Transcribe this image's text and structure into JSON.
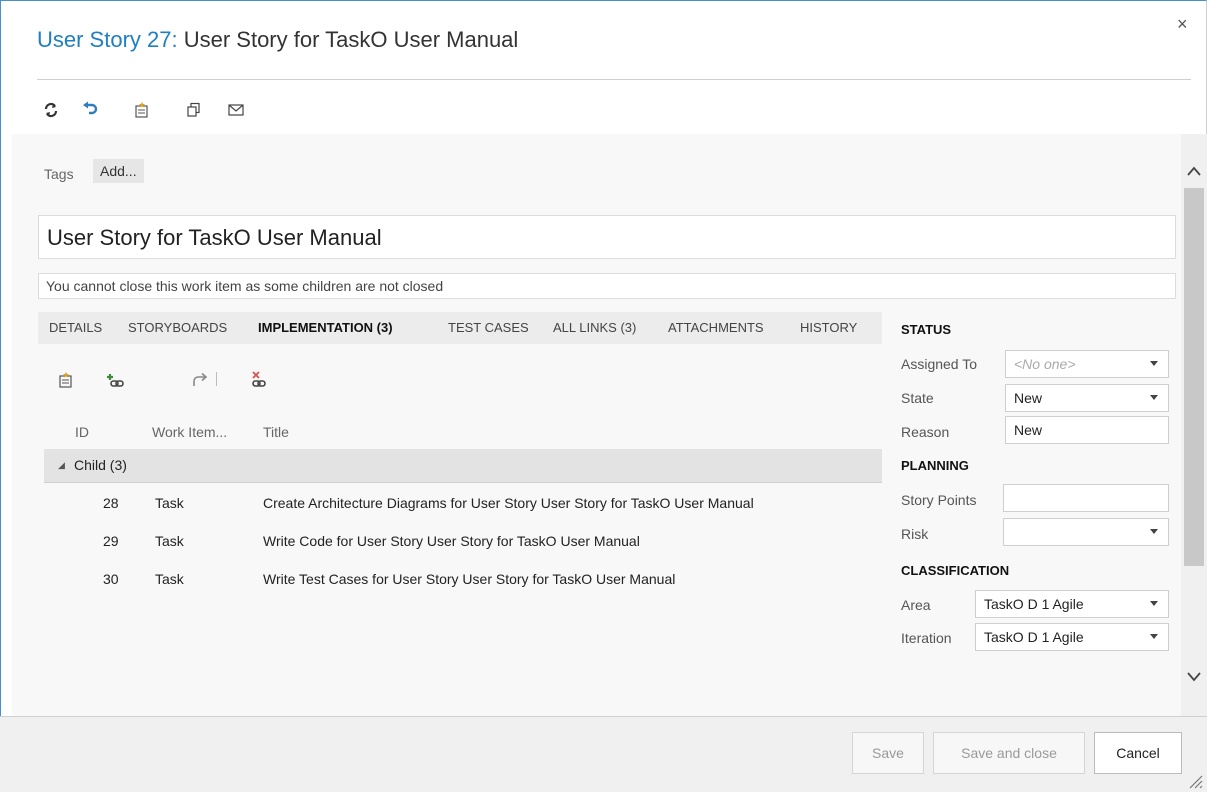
{
  "window": {
    "close_glyph": "×",
    "title_link": "User Story 27:",
    "title_rest": " User Story for TaskO User Manual"
  },
  "toolbar": {
    "items": [
      "refresh-icon",
      "undo-icon",
      "new-linked-work-item-icon",
      "copy-icon",
      "email-icon"
    ]
  },
  "tags": {
    "label": "Tags",
    "add_label": "Add..."
  },
  "work_item": {
    "title": "User Story for TaskO User Manual",
    "warning": "You cannot close this work item as some children are not closed"
  },
  "tabs": [
    {
      "label": "DETAILS"
    },
    {
      "label": "STORYBOARDS"
    },
    {
      "label": "IMPLEMENTATION (3)",
      "active": true
    },
    {
      "label": "TEST CASES"
    },
    {
      "label": "ALL LINKS (3)"
    },
    {
      "label": "ATTACHMENTS"
    },
    {
      "label": "HISTORY"
    }
  ],
  "links_grid": {
    "columns": {
      "id": "ID",
      "type": "Work Item...",
      "title": "Title"
    },
    "group_label": "Child (3)",
    "rows": [
      {
        "id": "28",
        "type": "Task",
        "title": "Create Architecture Diagrams for User Story User Story for TaskO User Manual"
      },
      {
        "id": "29",
        "type": "Task",
        "title": "Write Code for User Story User Story for TaskO User Manual"
      },
      {
        "id": "30",
        "type": "Task",
        "title": "Write Test Cases for User Story User Story for TaskO User Manual"
      }
    ]
  },
  "status": {
    "heading": "STATUS",
    "assigned_to_label": "Assigned To",
    "assigned_to_value": "<No one>",
    "state_label": "State",
    "state_value": "New",
    "reason_label": "Reason",
    "reason_value": "New"
  },
  "planning": {
    "heading": "PLANNING",
    "story_points_label": "Story Points",
    "story_points_value": "",
    "risk_label": "Risk",
    "risk_value": ""
  },
  "classification": {
    "heading": "CLASSIFICATION",
    "area_label": "Area",
    "area_value": "TaskO D 1 Agile",
    "iteration_label": "Iteration",
    "iteration_value": "TaskO D 1 Agile"
  },
  "footer": {
    "save_label": "Save",
    "save_close_label": "Save and close",
    "cancel_label": "Cancel"
  },
  "colors": {
    "accent_link": "#1f7fc0",
    "delete_red": "#d9534f",
    "add_green": "#3c8b3c"
  }
}
